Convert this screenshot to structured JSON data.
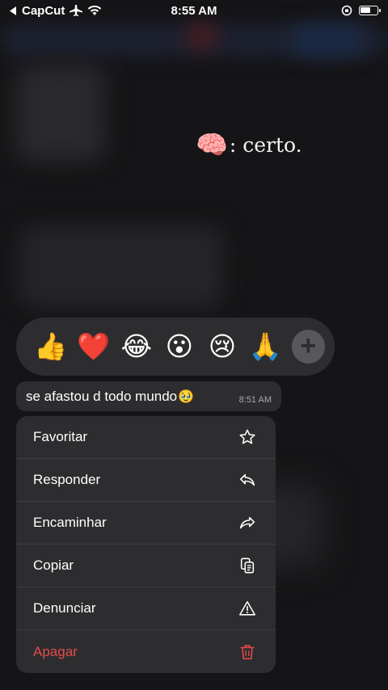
{
  "status_bar": {
    "back_app": "CapCut",
    "time": "8:55 AM"
  },
  "caption": {
    "emoji": "🧠",
    "text": ": certo."
  },
  "reactions": [
    "👍",
    "❤️",
    "😂",
    "😮",
    "😢",
    "🙏"
  ],
  "message": {
    "text": "se afastou d todo mundo",
    "emoji": "🥹",
    "time": "8:51 AM"
  },
  "menu": {
    "items": [
      {
        "label": "Favoritar",
        "icon": "star-icon"
      },
      {
        "label": "Responder",
        "icon": "reply-icon"
      },
      {
        "label": "Encaminhar",
        "icon": "forward-icon"
      },
      {
        "label": "Copiar",
        "icon": "copy-icon"
      },
      {
        "label": "Denunciar",
        "icon": "warning-icon"
      },
      {
        "label": "Apagar",
        "icon": "trash-icon"
      }
    ]
  },
  "colors": {
    "background": "#151416",
    "panel": "#2d2d30",
    "danger": "#e64a47"
  }
}
